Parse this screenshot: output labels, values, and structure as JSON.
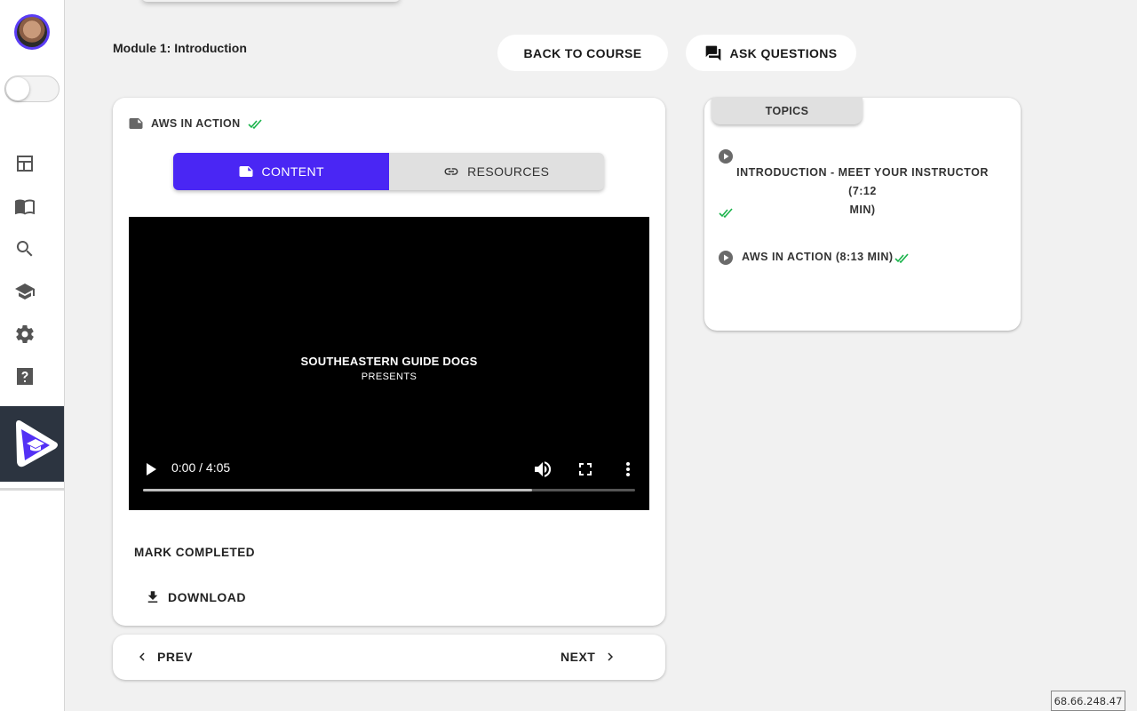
{
  "module": {
    "title": "Module 1: Introduction"
  },
  "header": {
    "back_label": "BACK TO COURSE",
    "ask_label": "ASK QUESTIONS"
  },
  "sidebar": {
    "items": [
      {
        "icon": "dashboard-icon"
      },
      {
        "icon": "book-icon"
      },
      {
        "icon": "search-icon"
      },
      {
        "icon": "graduation-cap-icon"
      },
      {
        "icon": "gear-icon"
      },
      {
        "icon": "help-icon"
      }
    ],
    "toggle_on": false
  },
  "lesson": {
    "title": "AWS IN ACTION",
    "completed": true
  },
  "tabs": [
    {
      "label": "CONTENT",
      "icon": "doc-icon",
      "active": true
    },
    {
      "label": "RESOURCES",
      "icon": "link-icon",
      "active": false
    }
  ],
  "video": {
    "line1": "SOUTHEASTERN GUIDE DOGS",
    "line2": "PRESENTS",
    "time": "0:00 / 4:05",
    "buffered": 0.79
  },
  "actions": {
    "mark_completed": "MARK COMPLETED",
    "download": "DOWNLOAD"
  },
  "pager": {
    "prev": "PREV",
    "next": "NEXT"
  },
  "topics": {
    "header": "TOPICS",
    "items": [
      {
        "title_line1": "INTRODUCTION - MEET YOUR INSTRUCTOR (7:12",
        "title_line2": "MIN)",
        "completed": true
      },
      {
        "title": "AWS IN ACTION (8:13 MIN)",
        "completed": true
      }
    ]
  },
  "colors": {
    "accent": "#4a26f4",
    "check": "#19b34a",
    "sidebar_brand": "#2c3440"
  },
  "footer": {
    "ip": "68.66.248.47"
  }
}
